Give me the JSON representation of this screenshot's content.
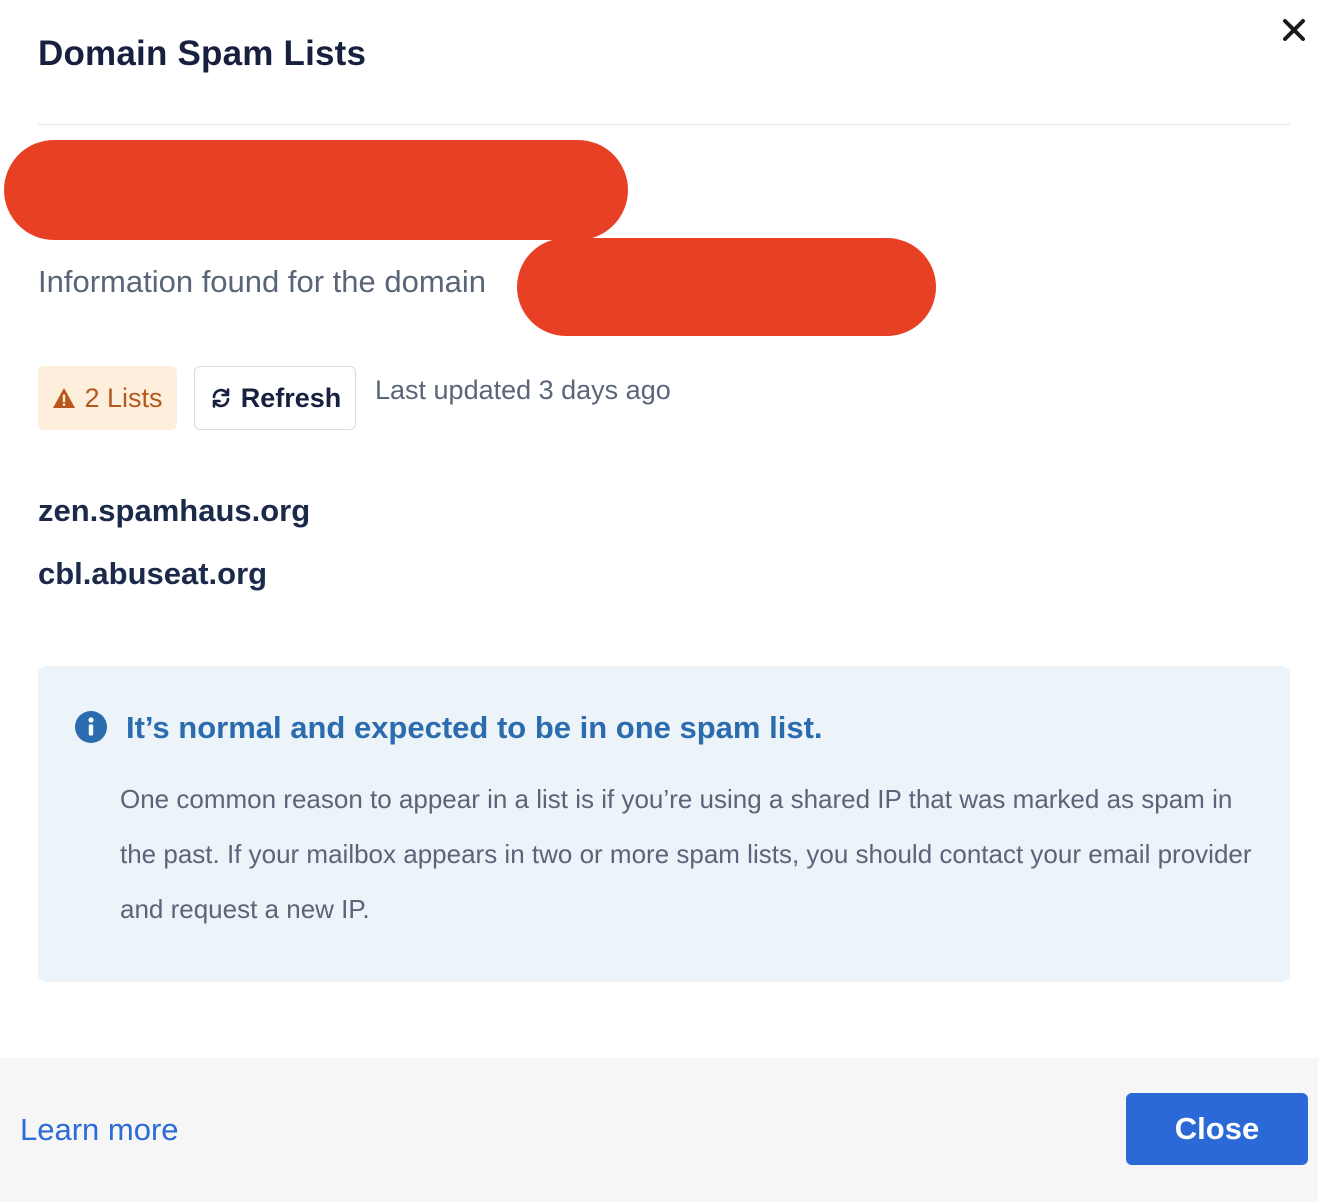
{
  "modal": {
    "title": "Domain Spam Lists",
    "close_icon": "close-icon"
  },
  "info": {
    "prefix": "Information found for the domain"
  },
  "status": {
    "lists_badge_icon": "warning-icon",
    "lists_badge_label": "2 Lists",
    "refresh_icon": "refresh-icon",
    "refresh_label": "Refresh",
    "last_updated": "Last updated 3 days ago"
  },
  "spam_lists": [
    "zen.spamhaus.org",
    "cbl.abuseat.org"
  ],
  "notice": {
    "icon": "info-icon",
    "title": "It’s normal and expected to be in one spam list.",
    "body": "One common reason to appear in a list is if you’re using a shared IP that was marked as spam in the past. If your mailbox appears in two or more spam lists, you should contact your email provider and request a new IP."
  },
  "footer": {
    "learn_more": "Learn more",
    "close_label": "Close"
  },
  "colors": {
    "accent": "#2b6ad6",
    "warning_bg": "#fdefdb",
    "warning_text": "#b5571e",
    "notice_bg": "#ecf3f9",
    "notice_title": "#2b6cae",
    "redaction": "#e84025"
  }
}
